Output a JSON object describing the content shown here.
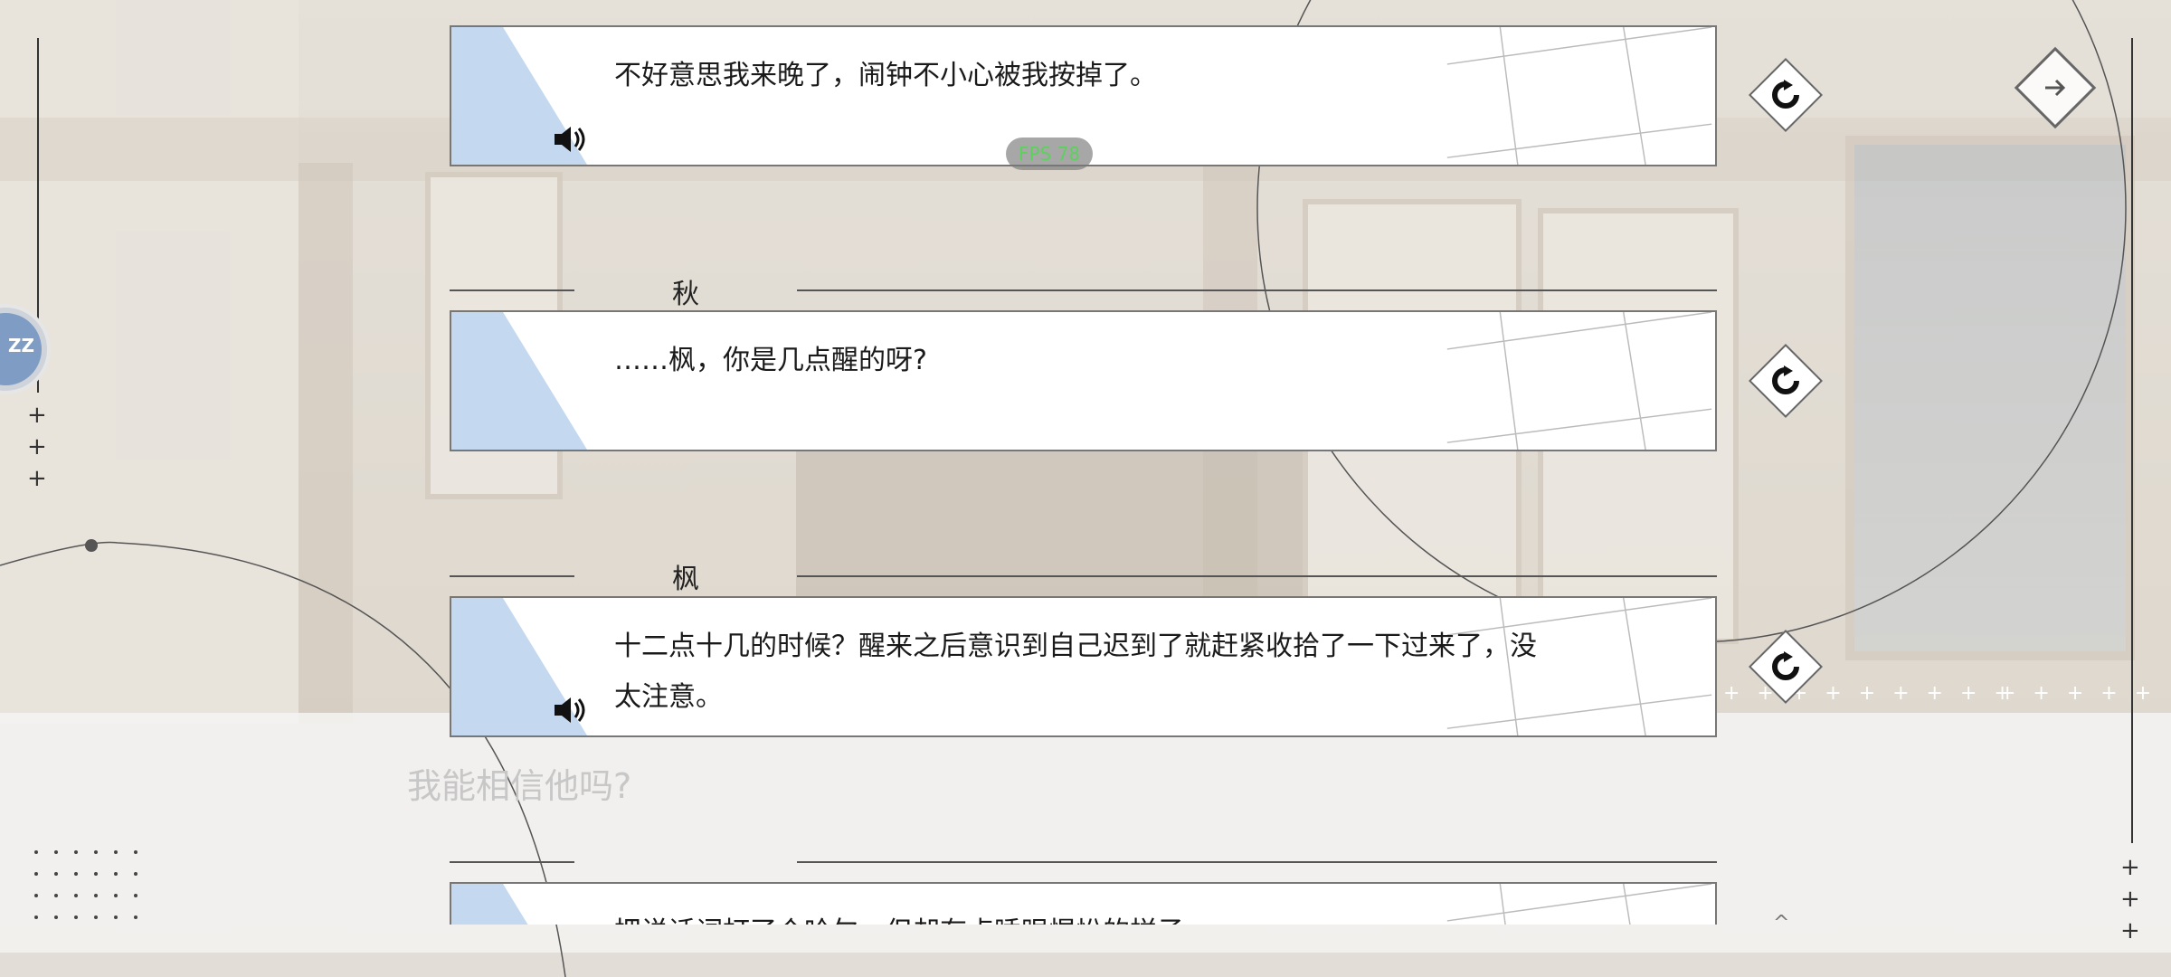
{
  "fps": "FPS 78",
  "avatar_label": "ZZ",
  "choice_text": "我能相信他吗?",
  "log_entries": [
    {
      "speaker": "",
      "text": "不好意思我来晚了，闹钟不小心被我按掉了。",
      "has_voice": true
    },
    {
      "speaker": "秋",
      "text": "……枫，你是几点醒的呀?",
      "has_voice": false
    },
    {
      "speaker": "枫",
      "text": "十二点十几的时候？醒来之后意识到自己迟到了就赶紧收拾了一下过来了，没太注意。",
      "has_voice": true
    },
    {
      "speaker": "",
      "text": "把说话词打了个哈欠，但却有点睡眼惺忪的样子。",
      "has_voice": false
    }
  ],
  "colors": {
    "accent_blue": "#c4d9ef",
    "fps_green": "#5dd05d"
  },
  "icons": {
    "replay": "replay-icon",
    "voice": "speaker-icon",
    "next": "arrow-right-icon"
  }
}
